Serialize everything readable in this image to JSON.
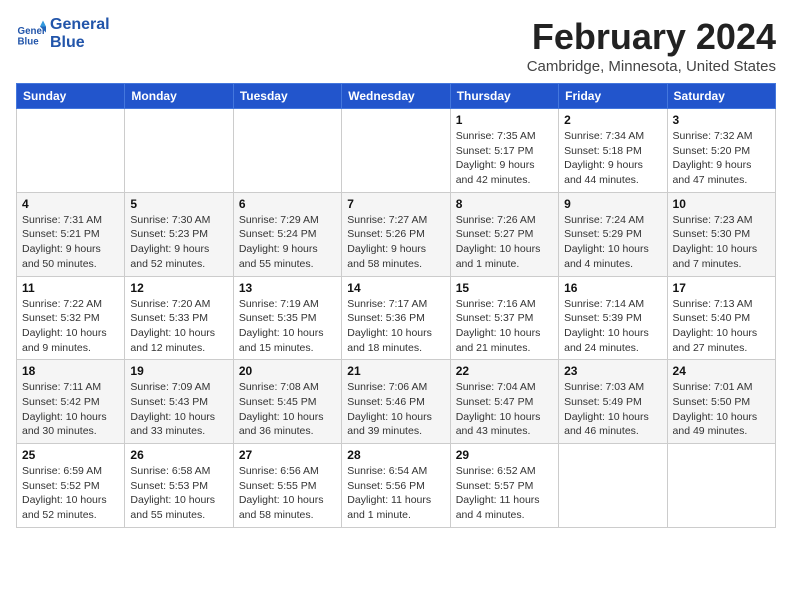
{
  "header": {
    "logo_line1": "General",
    "logo_line2": "Blue",
    "month_year": "February 2024",
    "location": "Cambridge, Minnesota, United States"
  },
  "days_of_week": [
    "Sunday",
    "Monday",
    "Tuesday",
    "Wednesday",
    "Thursday",
    "Friday",
    "Saturday"
  ],
  "weeks": [
    [
      {
        "day": "",
        "sunrise": "",
        "sunset": "",
        "daylight": ""
      },
      {
        "day": "",
        "sunrise": "",
        "sunset": "",
        "daylight": ""
      },
      {
        "day": "",
        "sunrise": "",
        "sunset": "",
        "daylight": ""
      },
      {
        "day": "",
        "sunrise": "",
        "sunset": "",
        "daylight": ""
      },
      {
        "day": "1",
        "sunrise": "Sunrise: 7:35 AM",
        "sunset": "Sunset: 5:17 PM",
        "daylight": "Daylight: 9 hours and 42 minutes."
      },
      {
        "day": "2",
        "sunrise": "Sunrise: 7:34 AM",
        "sunset": "Sunset: 5:18 PM",
        "daylight": "Daylight: 9 hours and 44 minutes."
      },
      {
        "day": "3",
        "sunrise": "Sunrise: 7:32 AM",
        "sunset": "Sunset: 5:20 PM",
        "daylight": "Daylight: 9 hours and 47 minutes."
      }
    ],
    [
      {
        "day": "4",
        "sunrise": "Sunrise: 7:31 AM",
        "sunset": "Sunset: 5:21 PM",
        "daylight": "Daylight: 9 hours and 50 minutes."
      },
      {
        "day": "5",
        "sunrise": "Sunrise: 7:30 AM",
        "sunset": "Sunset: 5:23 PM",
        "daylight": "Daylight: 9 hours and 52 minutes."
      },
      {
        "day": "6",
        "sunrise": "Sunrise: 7:29 AM",
        "sunset": "Sunset: 5:24 PM",
        "daylight": "Daylight: 9 hours and 55 minutes."
      },
      {
        "day": "7",
        "sunrise": "Sunrise: 7:27 AM",
        "sunset": "Sunset: 5:26 PM",
        "daylight": "Daylight: 9 hours and 58 minutes."
      },
      {
        "day": "8",
        "sunrise": "Sunrise: 7:26 AM",
        "sunset": "Sunset: 5:27 PM",
        "daylight": "Daylight: 10 hours and 1 minute."
      },
      {
        "day": "9",
        "sunrise": "Sunrise: 7:24 AM",
        "sunset": "Sunset: 5:29 PM",
        "daylight": "Daylight: 10 hours and 4 minutes."
      },
      {
        "day": "10",
        "sunrise": "Sunrise: 7:23 AM",
        "sunset": "Sunset: 5:30 PM",
        "daylight": "Daylight: 10 hours and 7 minutes."
      }
    ],
    [
      {
        "day": "11",
        "sunrise": "Sunrise: 7:22 AM",
        "sunset": "Sunset: 5:32 PM",
        "daylight": "Daylight: 10 hours and 9 minutes."
      },
      {
        "day": "12",
        "sunrise": "Sunrise: 7:20 AM",
        "sunset": "Sunset: 5:33 PM",
        "daylight": "Daylight: 10 hours and 12 minutes."
      },
      {
        "day": "13",
        "sunrise": "Sunrise: 7:19 AM",
        "sunset": "Sunset: 5:35 PM",
        "daylight": "Daylight: 10 hours and 15 minutes."
      },
      {
        "day": "14",
        "sunrise": "Sunrise: 7:17 AM",
        "sunset": "Sunset: 5:36 PM",
        "daylight": "Daylight: 10 hours and 18 minutes."
      },
      {
        "day": "15",
        "sunrise": "Sunrise: 7:16 AM",
        "sunset": "Sunset: 5:37 PM",
        "daylight": "Daylight: 10 hours and 21 minutes."
      },
      {
        "day": "16",
        "sunrise": "Sunrise: 7:14 AM",
        "sunset": "Sunset: 5:39 PM",
        "daylight": "Daylight: 10 hours and 24 minutes."
      },
      {
        "day": "17",
        "sunrise": "Sunrise: 7:13 AM",
        "sunset": "Sunset: 5:40 PM",
        "daylight": "Daylight: 10 hours and 27 minutes."
      }
    ],
    [
      {
        "day": "18",
        "sunrise": "Sunrise: 7:11 AM",
        "sunset": "Sunset: 5:42 PM",
        "daylight": "Daylight: 10 hours and 30 minutes."
      },
      {
        "day": "19",
        "sunrise": "Sunrise: 7:09 AM",
        "sunset": "Sunset: 5:43 PM",
        "daylight": "Daylight: 10 hours and 33 minutes."
      },
      {
        "day": "20",
        "sunrise": "Sunrise: 7:08 AM",
        "sunset": "Sunset: 5:45 PM",
        "daylight": "Daylight: 10 hours and 36 minutes."
      },
      {
        "day": "21",
        "sunrise": "Sunrise: 7:06 AM",
        "sunset": "Sunset: 5:46 PM",
        "daylight": "Daylight: 10 hours and 39 minutes."
      },
      {
        "day": "22",
        "sunrise": "Sunrise: 7:04 AM",
        "sunset": "Sunset: 5:47 PM",
        "daylight": "Daylight: 10 hours and 43 minutes."
      },
      {
        "day": "23",
        "sunrise": "Sunrise: 7:03 AM",
        "sunset": "Sunset: 5:49 PM",
        "daylight": "Daylight: 10 hours and 46 minutes."
      },
      {
        "day": "24",
        "sunrise": "Sunrise: 7:01 AM",
        "sunset": "Sunset: 5:50 PM",
        "daylight": "Daylight: 10 hours and 49 minutes."
      }
    ],
    [
      {
        "day": "25",
        "sunrise": "Sunrise: 6:59 AM",
        "sunset": "Sunset: 5:52 PM",
        "daylight": "Daylight: 10 hours and 52 minutes."
      },
      {
        "day": "26",
        "sunrise": "Sunrise: 6:58 AM",
        "sunset": "Sunset: 5:53 PM",
        "daylight": "Daylight: 10 hours and 55 minutes."
      },
      {
        "day": "27",
        "sunrise": "Sunrise: 6:56 AM",
        "sunset": "Sunset: 5:55 PM",
        "daylight": "Daylight: 10 hours and 58 minutes."
      },
      {
        "day": "28",
        "sunrise": "Sunrise: 6:54 AM",
        "sunset": "Sunset: 5:56 PM",
        "daylight": "Daylight: 11 hours and 1 minute."
      },
      {
        "day": "29",
        "sunrise": "Sunrise: 6:52 AM",
        "sunset": "Sunset: 5:57 PM",
        "daylight": "Daylight: 11 hours and 4 minutes."
      },
      {
        "day": "",
        "sunrise": "",
        "sunset": "",
        "daylight": ""
      },
      {
        "day": "",
        "sunrise": "",
        "sunset": "",
        "daylight": ""
      }
    ]
  ]
}
